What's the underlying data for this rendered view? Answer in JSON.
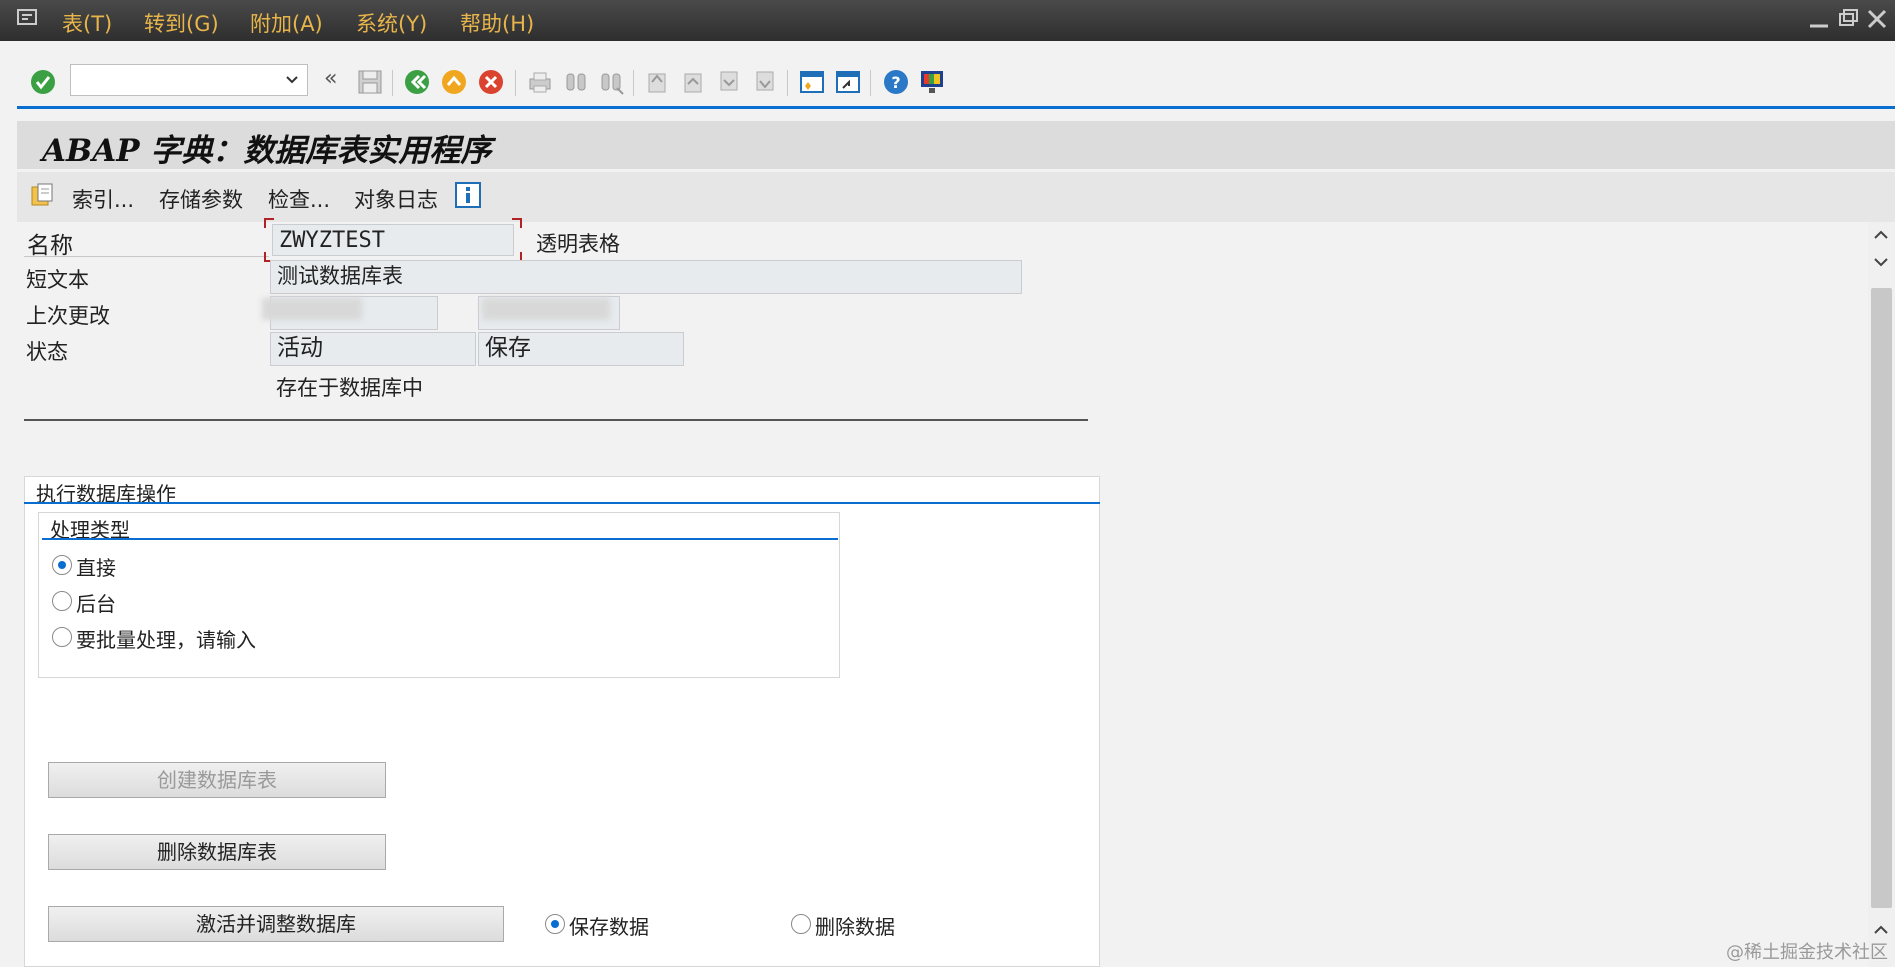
{
  "menu": {
    "items": [
      "表(T)",
      "转到(G)",
      "附加(A)",
      "系统(Y)",
      "帮助(H)"
    ]
  },
  "toolbar": {
    "command_value": "",
    "back_glyph": "«",
    "icons": [
      "enter-icon",
      "save-icon",
      "back-icon",
      "exit-icon",
      "cancel-icon",
      "print-icon",
      "find-icon",
      "find-next-icon",
      "first-page-icon",
      "previous-page-icon",
      "next-page-icon",
      "last-page-icon",
      "create-session-icon",
      "shortcut-icon",
      "help-icon",
      "customize-layout-icon"
    ],
    "accent": "#0a6ed1"
  },
  "page": {
    "title": "ABAP 字典：数据库表实用程序"
  },
  "app_toolbar": {
    "items": [
      "索引...",
      "存储参数",
      "检查...",
      "对象日志"
    ]
  },
  "form": {
    "name_label": "名称",
    "name_value": "ZWYZTEST",
    "name_type": "透明表格",
    "short_text_label": "短文本",
    "short_text_value": "测试数据库表",
    "last_change_label": "上次更改",
    "status_label": "状态",
    "status_value_1": "活动",
    "status_value_2": "保存",
    "status_note": "存在于数据库中"
  },
  "db_ops": {
    "title": "执行数据库操作",
    "processing": {
      "title": "处理类型",
      "options": [
        "直接",
        "后台",
        "要批量处理，请输入"
      ],
      "selected": 0
    },
    "buttons": {
      "create": "创建数据库表",
      "delete": "删除数据库表",
      "activate": "激活并调整数据库"
    },
    "data_options": [
      "保存数据",
      "删除数据"
    ],
    "data_selected": 0
  },
  "watermark": "@稀土掘金技术社区"
}
